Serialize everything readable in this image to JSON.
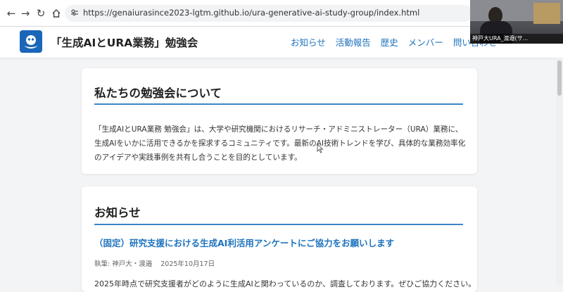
{
  "browser": {
    "url": "https://genaiurasince2023-lgtm.github.io/ura-generative-ai-study-group/index.html"
  },
  "webcam": {
    "label": "神戸大URA_渡邉(サ..."
  },
  "site": {
    "title": "「生成AIとURA業務」勉強会",
    "nav": [
      "お知らせ",
      "活動報告",
      "歴史",
      "メンバー",
      "問い合わせ"
    ]
  },
  "about": {
    "heading": "私たちの勉強会について",
    "body": "「生成AIとURA業務 勉強会」は、大学や研究機関におけるリサーチ・アドミニストレーター（URA）業務に、生成AIをいかに活用できるかを探求するコミュニティです。最新のAI技術トレンドを学び、具体的な業務効率化のアイデアや実践事例を共有し合うことを目的としています。"
  },
  "news": {
    "heading": "お知らせ",
    "item_title": "（固定）研究支援における生成AI利活用アンケートにご協力をお願いします",
    "author": "執筆: 神戸大・渡邉",
    "date": "2025年10月17日",
    "excerpt": "2025年時点で研究支援者がどのように生成AIと関わっているのか、調査しております。ぜひご協力ください。"
  },
  "colors": {
    "accent": "#1e73be",
    "rule": "#3b86c8",
    "logo": "#1a66b8"
  }
}
